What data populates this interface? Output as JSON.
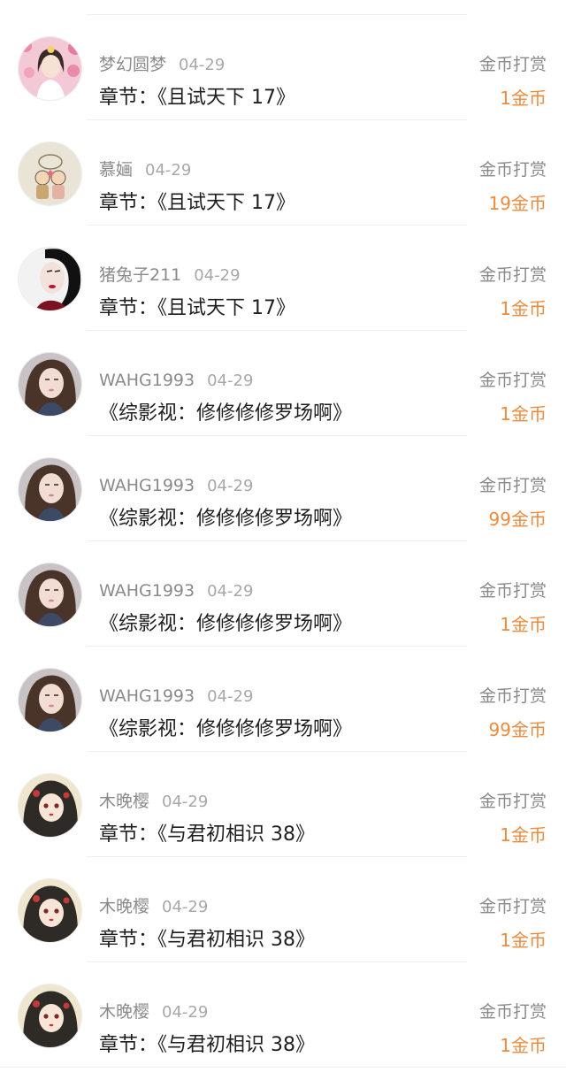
{
  "colors": {
    "amount": "#ee8a3c",
    "meta": "#8a8a8a",
    "title": "#1e1e1e",
    "divider": "#eeeeee"
  },
  "records": [
    {
      "user": "梦幻圆梦",
      "date": "04-29",
      "title": "章节：《且试天下 17》",
      "type": "金币打赏",
      "amount": "1金币",
      "avatar": "avatar-girl-pink-flowers-icon"
    },
    {
      "user": "慕婳",
      "date": "04-29",
      "title": "章节：《且试天下 17》",
      "type": "金币打赏",
      "amount": "19金币",
      "avatar": "avatar-cartoon-couple-icon"
    },
    {
      "user": "猪兔子211",
      "date": "04-29",
      "title": "章节：《且试天下 17》",
      "type": "金币打赏",
      "amount": "1金币",
      "avatar": "avatar-woman-red-lips-icon"
    },
    {
      "user": "WAHG1993",
      "date": "04-29",
      "title": "《综影视：修修修修罗场啊》",
      "type": "金币打赏",
      "amount": "1金币",
      "avatar": "avatar-woman-portrait-icon"
    },
    {
      "user": "WAHG1993",
      "date": "04-29",
      "title": "《综影视：修修修修罗场啊》",
      "type": "金币打赏",
      "amount": "99金币",
      "avatar": "avatar-woman-portrait-icon"
    },
    {
      "user": "WAHG1993",
      "date": "04-29",
      "title": "《综影视：修修修修罗场啊》",
      "type": "金币打赏",
      "amount": "1金币",
      "avatar": "avatar-woman-portrait-icon"
    },
    {
      "user": "WAHG1993",
      "date": "04-29",
      "title": "《综影视：修修修修罗场啊》",
      "type": "金币打赏",
      "amount": "99金币",
      "avatar": "avatar-woman-portrait-icon"
    },
    {
      "user": "木晚樱",
      "date": "04-29",
      "title": "章节：《与君初相识 38》",
      "type": "金币打赏",
      "amount": "1金币",
      "avatar": "avatar-anime-girl-icon"
    },
    {
      "user": "木晚樱",
      "date": "04-29",
      "title": "章节：《与君初相识 38》",
      "type": "金币打赏",
      "amount": "1金币",
      "avatar": "avatar-anime-girl-icon"
    },
    {
      "user": "木晚樱",
      "date": "04-29",
      "title": "章节：《与君初相识 38》",
      "type": "金币打赏",
      "amount": "1金币",
      "avatar": "avatar-anime-girl-icon"
    }
  ]
}
